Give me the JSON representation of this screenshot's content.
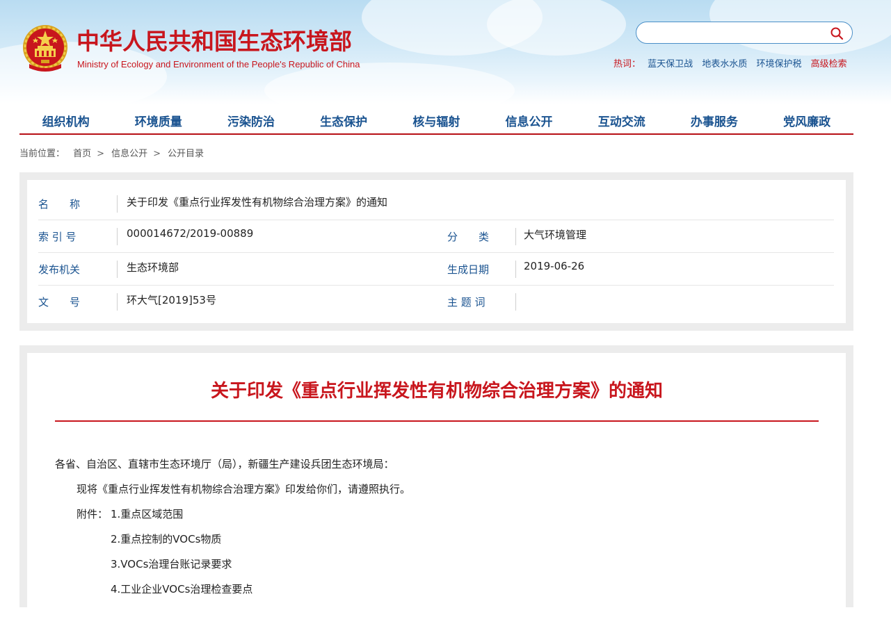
{
  "header": {
    "title": "中华人民共和国生态环境部",
    "subtitle": "Ministry of Ecology and Environment of the People's Republic of China",
    "search": {
      "placeholder": "",
      "icon": "search-icon"
    },
    "hot_label": "热词：",
    "hot_words": [
      "蓝天保卫战",
      "地表水水质",
      "环境保护税"
    ],
    "advanced_search": "高级检索"
  },
  "nav": {
    "items": [
      "组织机构",
      "环境质量",
      "污染防治",
      "生态保护",
      "核与辐射",
      "信息公开",
      "互动交流",
      "办事服务",
      "党风廉政"
    ]
  },
  "breadcrumb": {
    "label": "当前位置：",
    "items": [
      "首页",
      "信息公开",
      "公开目录"
    ],
    "separator": ">"
  },
  "meta": {
    "name_label": "名　　称",
    "name_value": "关于印发《重点行业挥发性有机物综合治理方案》的通知",
    "index_label": "索 引 号",
    "index_value": "000014672/2019-00889",
    "category_label": "分　　类",
    "category_value": "大气环境管理",
    "issuer_label": "发布机关",
    "issuer_value": "生态环境部",
    "date_label": "生成日期",
    "date_value": "2019-06-26",
    "doc_label": "文　　号",
    "doc_value": "环大气[2019]53号",
    "topic_label": "主 题 词",
    "topic_value": ""
  },
  "article": {
    "title": "关于印发《重点行业挥发性有机物综合治理方案》的通知",
    "salutation": "各省、自治区、直辖市生态环境厅（局），新疆生产建设兵团生态环境局：",
    "body": "现将《重点行业挥发性有机物综合治理方案》印发给你们，请遵照执行。",
    "attachments_label": "附件：",
    "attachments": [
      "1.重点区域范围",
      "2.重点控制的VOCs物质",
      "3.VOCs治理台账记录要求",
      "4.工业企业VOCs治理检查要点"
    ]
  },
  "colors": {
    "brand_red": "#c8161d",
    "link_blue": "#1a5390",
    "search_border": "#4a8fc7"
  }
}
